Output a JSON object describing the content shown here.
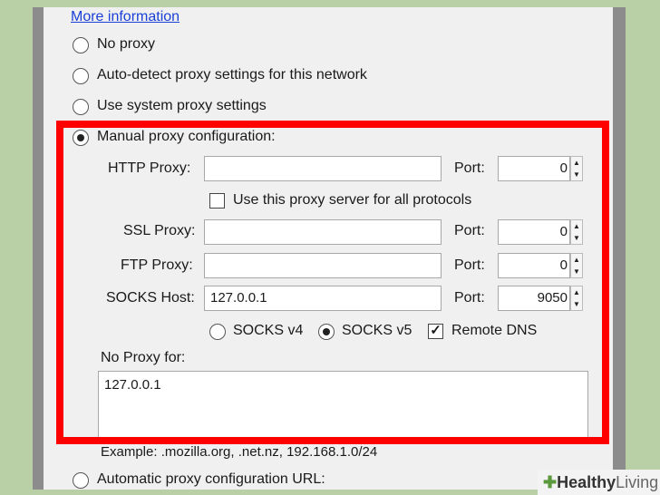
{
  "link": "More information",
  "options": {
    "no_proxy": "No proxy",
    "auto_detect": "Auto-detect proxy settings for this network",
    "system": "Use system proxy settings",
    "manual": "Manual proxy configuration:",
    "auto_url": "Automatic proxy configuration URL:"
  },
  "manual": {
    "http_label": "HTTP Proxy:",
    "http_value": "",
    "http_port": "0",
    "all_protocols": "Use this proxy server for all protocols",
    "ssl_label": "SSL Proxy:",
    "ssl_value": "",
    "ssl_port": "0",
    "ftp_label": "FTP Proxy:",
    "ftp_value": "",
    "ftp_port": "0",
    "socks_label": "SOCKS Host:",
    "socks_value": "127.0.0.1",
    "socks_port": "9050",
    "port_label": "Port:",
    "socks_v4": "SOCKS v4",
    "socks_v5": "SOCKS v5",
    "remote_dns": "Remote DNS",
    "no_proxy_label": "No Proxy for:",
    "no_proxy_value": "127.0.0.1"
  },
  "example": "Example: .mozilla.org, .net.nz, 192.168.1.0/24",
  "watermark": {
    "bold": "Healthy",
    "light": "Living"
  }
}
